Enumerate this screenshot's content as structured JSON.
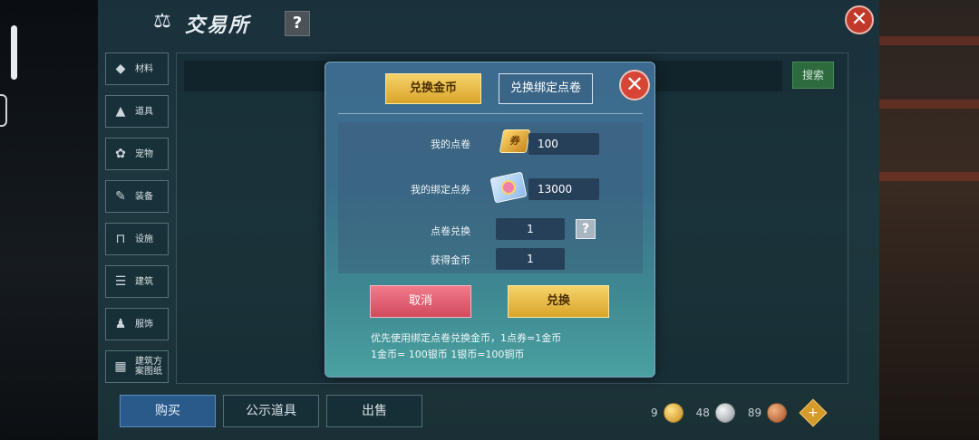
{
  "screen": {
    "title": "交易所",
    "help_glyph": "?",
    "close_glyph": "✕"
  },
  "categories": [
    {
      "label": "材料",
      "icon": "material-icon"
    },
    {
      "label": "道具",
      "icon": "item-icon"
    },
    {
      "label": "宠物",
      "icon": "pet-icon"
    },
    {
      "label": "装备",
      "icon": "equipment-icon"
    },
    {
      "label": "设施",
      "icon": "facility-icon"
    },
    {
      "label": "建筑",
      "icon": "building-icon"
    },
    {
      "label": "服饰",
      "icon": "costume-icon"
    },
    {
      "label": "建筑方案图纸",
      "icon": "blueprint-icon"
    }
  ],
  "search": {
    "button_label": "搜索"
  },
  "bottom_tabs": [
    {
      "label": "购买",
      "active": true
    },
    {
      "label": "公示道具",
      "active": false
    },
    {
      "label": "出售",
      "active": false
    }
  ],
  "currency": {
    "gold": "9",
    "silver": "48",
    "copper": "89"
  },
  "dialog": {
    "tab_active": "兑换金币",
    "tab_inactive": "兑换绑定点卷",
    "close_glyph": "✕",
    "rows": {
      "my_points_label": "我的点卷",
      "my_points_value": "100",
      "my_bound_label": "我的绑定点券",
      "my_bound_value": "13000",
      "exchange_label": "点卷兑换",
      "exchange_value": "1",
      "obtain_label": "获得金币",
      "obtain_value": "1"
    },
    "help_glyph": "?",
    "cancel_label": "取消",
    "confirm_label": "兑换",
    "note_line1": "优先使用绑定点卷兑换金币，1点券=1金币",
    "note_line2": "1金币= 100银币  1银币=100铜币"
  },
  "colors": {
    "accent_gold": "#d9a52a",
    "cancel_red": "#d24a5e",
    "close_red": "#d64535"
  }
}
